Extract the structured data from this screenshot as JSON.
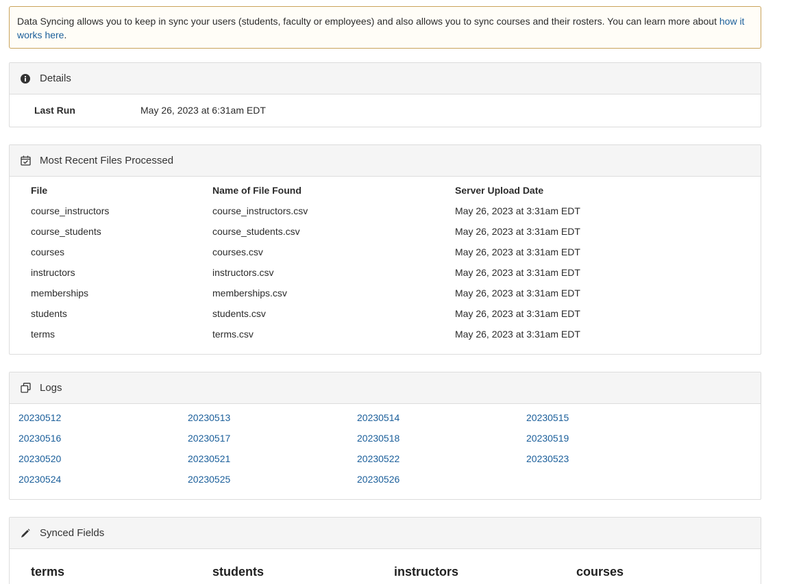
{
  "notice": {
    "text": "Data Syncing allows you to keep in sync your users (students, faculty or employees) and also allows you to sync courses and their rosters. You can learn more about ",
    "link_text": "how it works here",
    "suffix": "."
  },
  "details": {
    "title": "Details",
    "icon": "info-icon",
    "last_run_label": "Last Run",
    "last_run_value": "May 26, 2023 at 6:31am EDT"
  },
  "files": {
    "title": "Most Recent Files Processed",
    "icon": "calendar-check-icon",
    "columns": [
      "File",
      "Name of File Found",
      "Server Upload Date"
    ],
    "rows": [
      [
        "course_instructors",
        "course_instructors.csv",
        "May 26, 2023 at 3:31am EDT"
      ],
      [
        "course_students",
        "course_students.csv",
        "May 26, 2023 at 3:31am EDT"
      ],
      [
        "courses",
        "courses.csv",
        "May 26, 2023 at 3:31am EDT"
      ],
      [
        "instructors",
        "instructors.csv",
        "May 26, 2023 at 3:31am EDT"
      ],
      [
        "memberships",
        "memberships.csv",
        "May 26, 2023 at 3:31am EDT"
      ],
      [
        "students",
        "students.csv",
        "May 26, 2023 at 3:31am EDT"
      ],
      [
        "terms",
        "terms.csv",
        "May 26, 2023 at 3:31am EDT"
      ]
    ]
  },
  "logs": {
    "title": "Logs",
    "icon": "copy-icon",
    "items": [
      "20230512",
      "20230513",
      "20230514",
      "20230515",
      "20230516",
      "20230517",
      "20230518",
      "20230519",
      "20230520",
      "20230521",
      "20230522",
      "20230523",
      "20230524",
      "20230525",
      "20230526"
    ]
  },
  "fields": {
    "title": "Synced Fields",
    "icon": "pencil-icon",
    "columns": [
      "terms",
      "students",
      "instructors",
      "courses"
    ]
  },
  "colors": {
    "link": "#1a5e9a",
    "notice_border": "#c9a35b",
    "panel_header_bg": "#f5f5f5"
  }
}
